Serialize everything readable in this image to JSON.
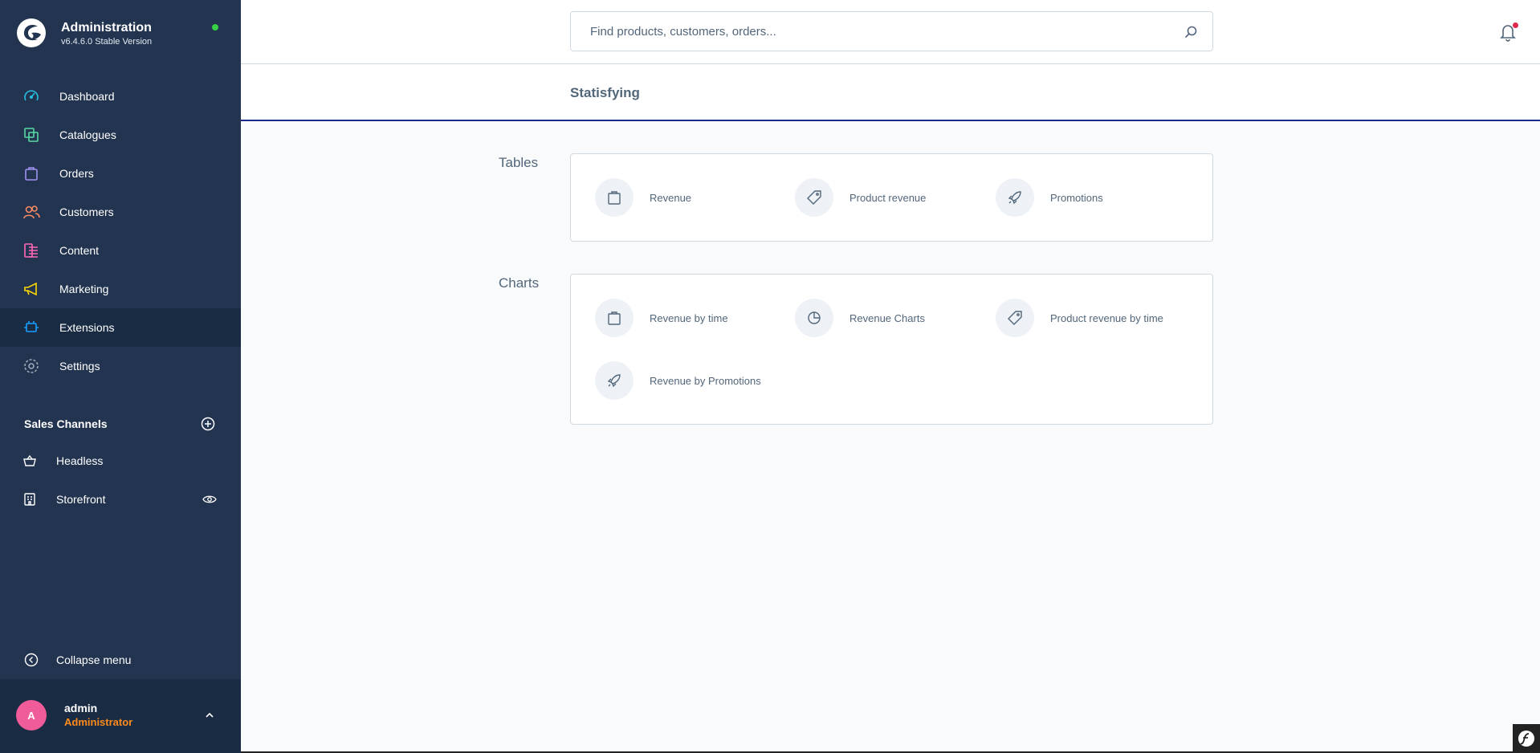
{
  "app": {
    "title": "Administration",
    "version": "v6.4.6.0 Stable Version"
  },
  "nav": {
    "items": [
      {
        "label": "Dashboard",
        "icon": "dashboard-icon",
        "color": "#26bfe1"
      },
      {
        "label": "Catalogues",
        "icon": "catalogues-icon",
        "color": "#57d9a3"
      },
      {
        "label": "Orders",
        "icon": "orders-icon",
        "color": "#a092f0"
      },
      {
        "label": "Customers",
        "icon": "customers-icon",
        "color": "#f88962"
      },
      {
        "label": "Content",
        "icon": "content-icon",
        "color": "#ff68b4"
      },
      {
        "label": "Marketing",
        "icon": "marketing-icon",
        "color": "#ffd700"
      },
      {
        "label": "Extensions",
        "icon": "extensions-icon",
        "color": "#189eff"
      },
      {
        "label": "Settings",
        "icon": "settings-icon",
        "color": "#9aa8b5"
      }
    ]
  },
  "sales_channels": {
    "header": "Sales Channels",
    "items": [
      {
        "label": "Headless",
        "icon": "basket-icon"
      },
      {
        "label": "Storefront",
        "icon": "storefront-icon"
      }
    ]
  },
  "collapse_label": "Collapse menu",
  "user": {
    "initial": "A",
    "name": "admin",
    "role": "Administrator"
  },
  "search": {
    "placeholder": "Find products, customers, orders..."
  },
  "page": {
    "title": "Statisfying"
  },
  "sections": {
    "tables": {
      "label": "Tables",
      "items": [
        {
          "label": "Revenue",
          "icon": "bag-icon"
        },
        {
          "label": "Product revenue",
          "icon": "tag-icon"
        },
        {
          "label": "Promotions",
          "icon": "rocket-icon"
        }
      ]
    },
    "charts": {
      "label": "Charts",
      "items": [
        {
          "label": "Revenue by time",
          "icon": "bag-icon"
        },
        {
          "label": "Revenue Charts",
          "icon": "pie-chart-icon"
        },
        {
          "label": "Product revenue by time",
          "icon": "tag-icon"
        },
        {
          "label": "Revenue by Promotions",
          "icon": "rocket-icon"
        }
      ]
    }
  },
  "colors": {
    "sidebar": "#233450",
    "accent_border": "#1a2b8c",
    "role": "#ff8c1a",
    "avatar": "#ef5c99",
    "status_dot": "#37d046"
  }
}
